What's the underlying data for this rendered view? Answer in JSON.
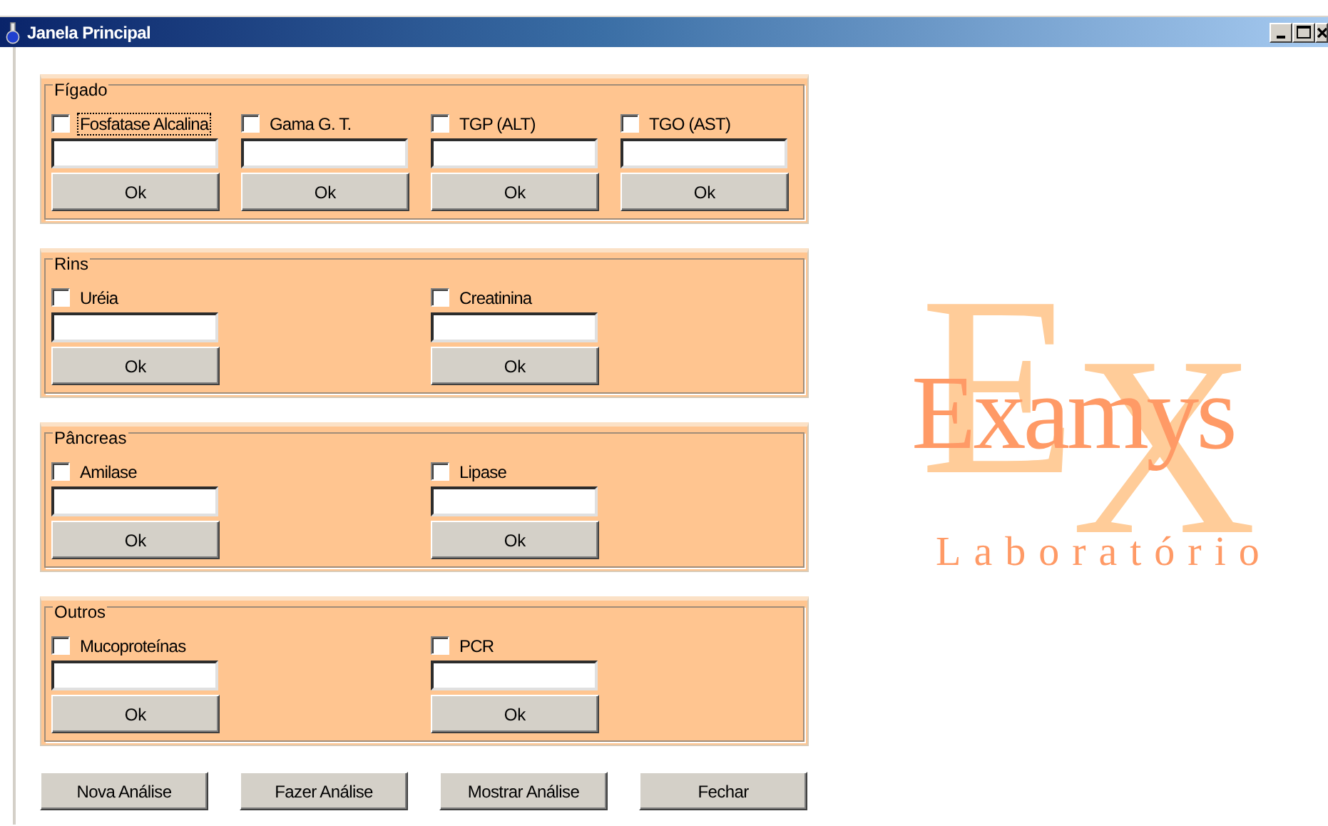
{
  "window": {
    "title": "Janela Principal"
  },
  "groups": [
    {
      "title": "Fígado",
      "tests": [
        {
          "label": "Fosfatase Alcalina",
          "checked": false,
          "focused": true,
          "button": "Ok"
        },
        {
          "label": "Gama G. T.",
          "checked": false,
          "focused": false,
          "button": "Ok"
        },
        {
          "label": "TGP (ALT)",
          "checked": false,
          "focused": false,
          "button": "Ok"
        },
        {
          "label": "TGO (AST)",
          "checked": false,
          "focused": false,
          "button": "Ok"
        }
      ]
    },
    {
      "title": "Rins",
      "tests": [
        {
          "label": "Uréia",
          "checked": false,
          "focused": false,
          "button": "Ok"
        },
        {
          "label": "Creatinina",
          "checked": false,
          "focused": false,
          "button": "Ok"
        }
      ]
    },
    {
      "title": "Pâncreas",
      "tests": [
        {
          "label": "Amilase",
          "checked": false,
          "focused": false,
          "button": "Ok"
        },
        {
          "label": "Lipase",
          "checked": false,
          "focused": false,
          "button": "Ok"
        }
      ]
    },
    {
      "title": "Outros",
      "tests": [
        {
          "label": "Mucoproteínas",
          "checked": false,
          "focused": false,
          "button": "Ok"
        },
        {
          "label": "PCR",
          "checked": false,
          "focused": false,
          "button": "Ok"
        }
      ]
    }
  ],
  "actions": [
    "Nova Análise",
    "Fazer Análise",
    "Mostrar Análise",
    "Fechar"
  ],
  "logo": {
    "big_letter_1": "E",
    "big_letter_2": "X",
    "name": "Examys",
    "subtitle": "Laboratório"
  }
}
